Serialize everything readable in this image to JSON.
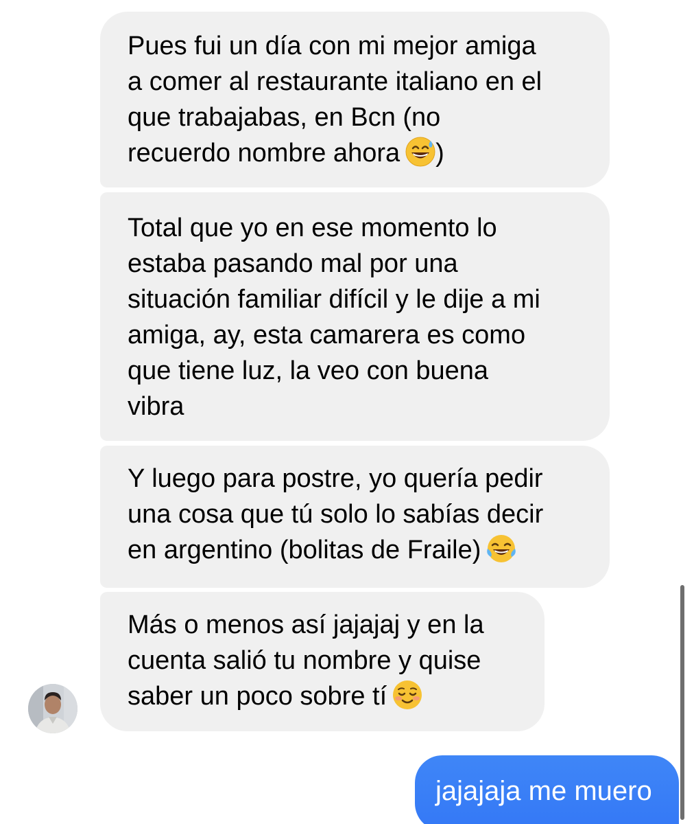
{
  "conversation": {
    "incoming": [
      {
        "lines": [
          "Pues fui un día con mi mejor amiga",
          "a comer al restaurante italiano en el",
          "que trabajabas, en Bcn (no",
          "recuerdo nombre ahora"
        ],
        "line4_suffix": ")",
        "emoji": "sweat-smile-emoji"
      },
      {
        "lines": [
          "Total que yo en ese momento lo",
          "estaba pasando mal por una",
          "situación familiar difícil y le dije a mi",
          "amiga, ay, esta camarera es como",
          "que tiene luz, la veo con buena",
          "vibra"
        ]
      },
      {
        "lines": [
          "Y luego para postre, yo quería pedir",
          "una cosa que tú solo lo sabías decir",
          "en argentino (bolitas de Fraile)"
        ],
        "emoji": "tears-of-joy-emoji"
      },
      {
        "lines": [
          "Más o menos así jajajaj y en la",
          "cuenta salió tu nombre y quise",
          "saber un poco sobre tí"
        ],
        "emoji": "smiling-blush-emoji"
      }
    ],
    "outgoing": [
      {
        "text": "jajajaja me muero"
      }
    ],
    "sender_avatar": "contact-avatar"
  },
  "colors": {
    "incoming_bubble": "#f0f0f0",
    "outgoing_bubble": "#3b82f6",
    "outgoing_text": "#ffffff",
    "incoming_text": "#000000"
  }
}
